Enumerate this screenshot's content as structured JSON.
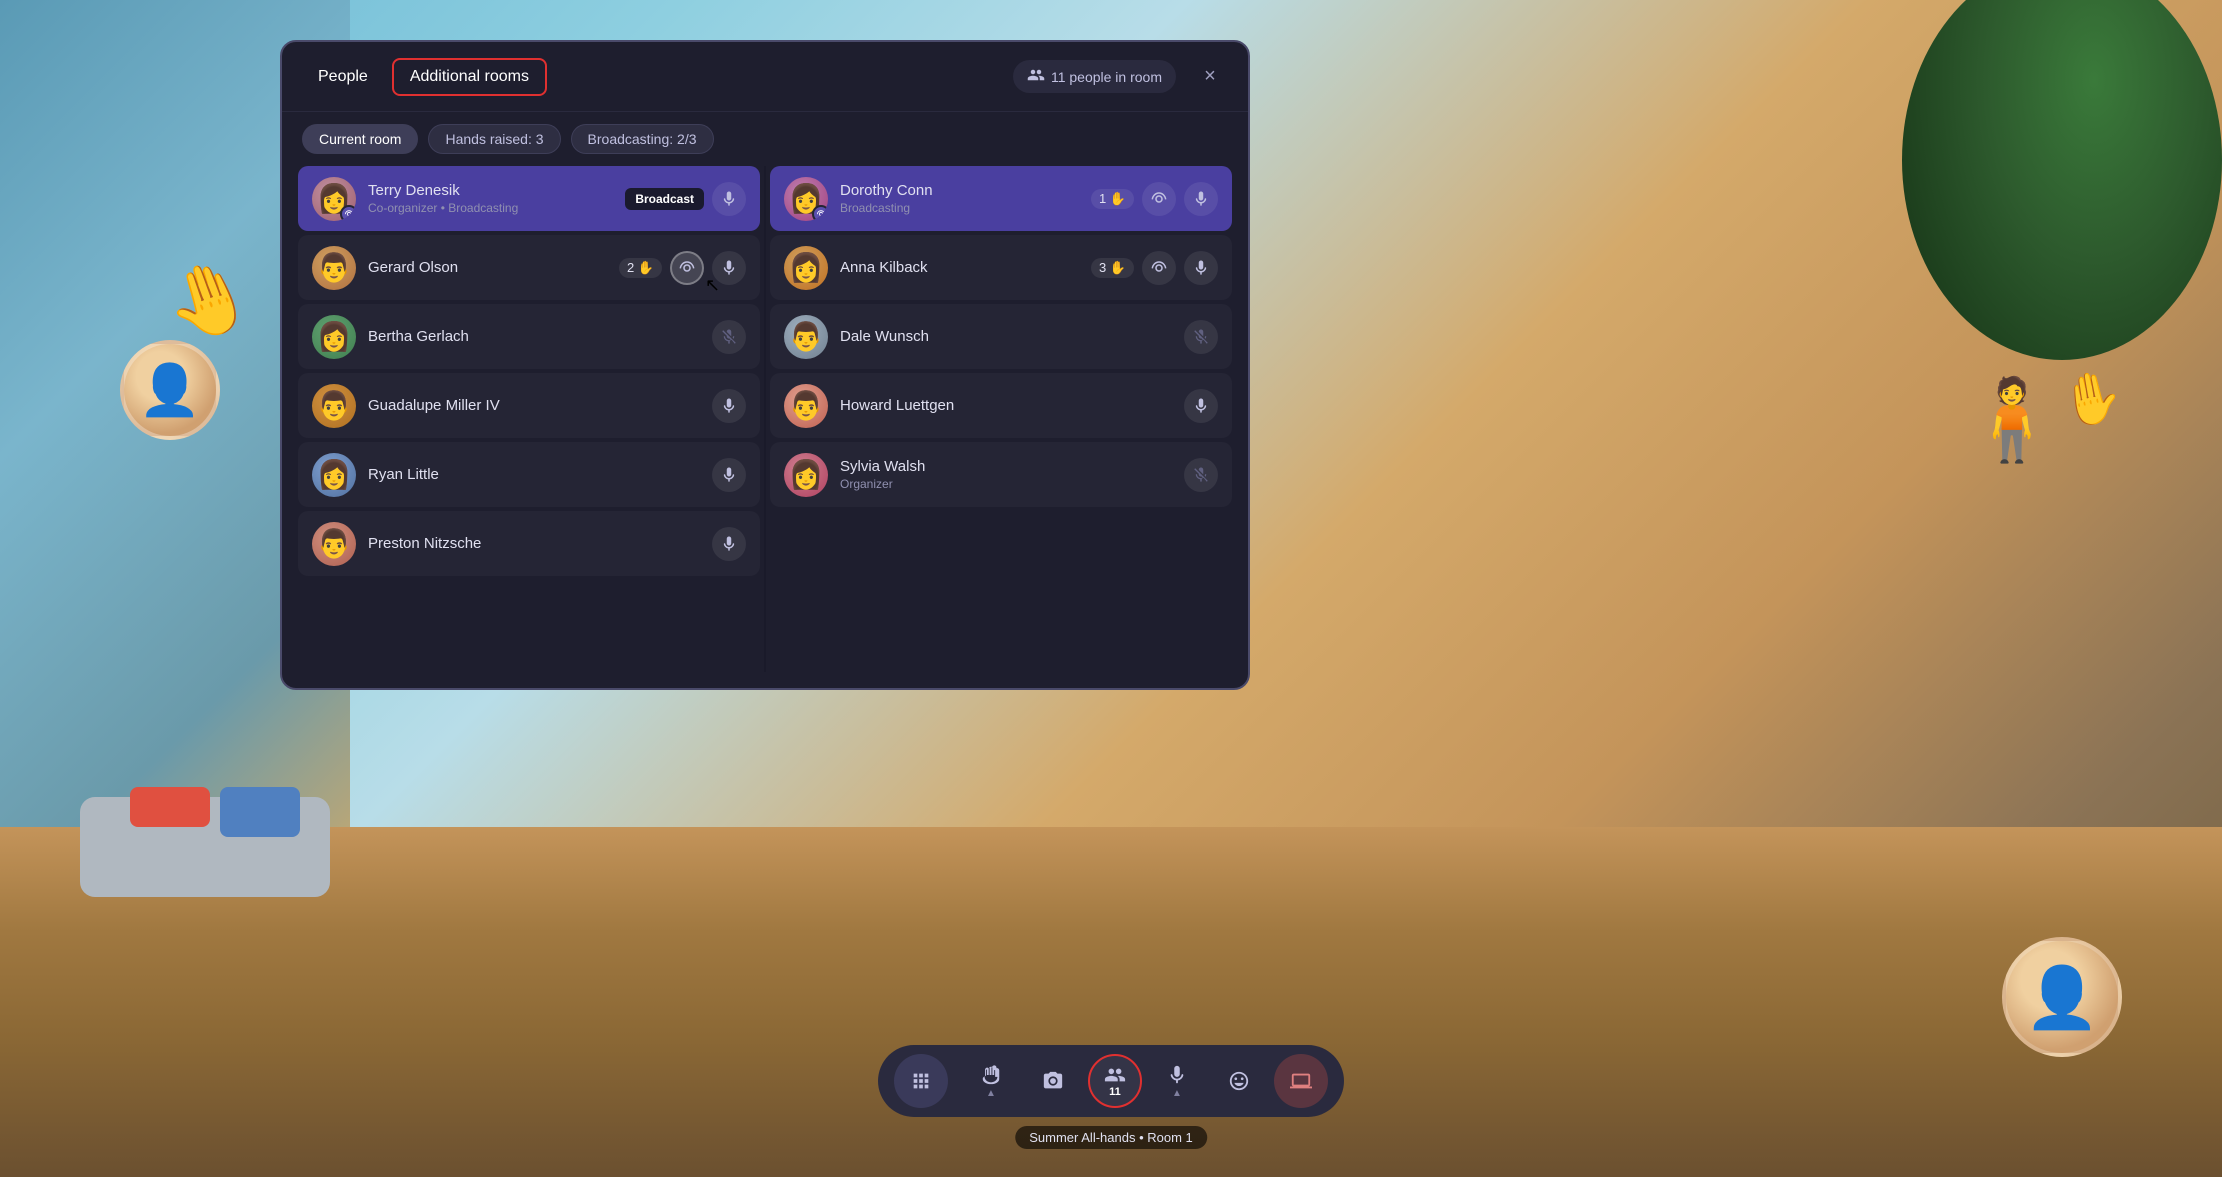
{
  "background": {
    "hand_emoji": "🤚",
    "hand_right_emoji": "✋"
  },
  "panel": {
    "tab_people": "People",
    "tab_additional_rooms": "Additional rooms",
    "people_count": "11 people in room",
    "close_label": "×",
    "filter_current_room": "Current room",
    "filter_hands_raised": "Hands raised: 3",
    "filter_broadcasting": "Broadcasting: 2/3"
  },
  "people": [
    {
      "id": "terry",
      "name": "Terry Denesik",
      "role": "Co-organizer • Broadcasting",
      "column": 0,
      "broadcasting": true,
      "badge": "Broadcast",
      "has_broadcast_icon": true,
      "mic_active": true,
      "muted": false,
      "avatar_class": "avatar-terry",
      "avatar_emoji": "👩"
    },
    {
      "id": "dorothy",
      "name": "Dorothy Conn",
      "role": "Broadcasting",
      "column": 1,
      "broadcasting": true,
      "hand_count": "1",
      "has_broadcast_icon": true,
      "mic_active": true,
      "muted": false,
      "avatar_class": "avatar-dorothy",
      "avatar_emoji": "👩"
    },
    {
      "id": "gerard",
      "name": "Gerard Olson",
      "role": "",
      "column": 0,
      "broadcasting": false,
      "hand_count": "2",
      "has_broadcast_icon": true,
      "broadcast_active": true,
      "mic_active": true,
      "muted": false,
      "avatar_class": "avatar-gerard",
      "avatar_emoji": "👨"
    },
    {
      "id": "anna",
      "name": "Anna Kilback",
      "role": "",
      "column": 1,
      "broadcasting": false,
      "hand_count": "3",
      "has_broadcast_icon": true,
      "mic_active": true,
      "muted": false,
      "avatar_class": "avatar-anna",
      "avatar_emoji": "👩"
    },
    {
      "id": "bertha",
      "name": "Bertha Gerlach",
      "role": "",
      "column": 0,
      "broadcasting": false,
      "mic_active": false,
      "muted": true,
      "avatar_class": "avatar-bertha",
      "avatar_emoji": "👩"
    },
    {
      "id": "dale",
      "name": "Dale Wunsch",
      "role": "",
      "column": 1,
      "broadcasting": false,
      "mic_active": false,
      "muted": true,
      "avatar_class": "avatar-dale",
      "avatar_emoji": "👨"
    },
    {
      "id": "guadalupe",
      "name": "Guadalupe Miller IV",
      "role": "",
      "column": 0,
      "broadcasting": false,
      "mic_active": true,
      "muted": false,
      "avatar_class": "avatar-guadalupe",
      "avatar_emoji": "👨"
    },
    {
      "id": "howard",
      "name": "Howard Luettgen",
      "role": "",
      "column": 1,
      "broadcasting": false,
      "mic_active": true,
      "muted": false,
      "avatar_class": "avatar-howard",
      "avatar_emoji": "👨"
    },
    {
      "id": "ryan",
      "name": "Ryan Little",
      "role": "",
      "column": 0,
      "broadcasting": false,
      "mic_active": true,
      "muted": false,
      "avatar_class": "avatar-ryan",
      "avatar_emoji": "👩"
    },
    {
      "id": "sylvia",
      "name": "Sylvia Walsh",
      "role": "Organizer",
      "column": 1,
      "broadcasting": false,
      "mic_active": false,
      "muted": true,
      "avatar_class": "avatar-sylvia",
      "avatar_emoji": "👩"
    },
    {
      "id": "preston",
      "name": "Preston Nitzsche",
      "role": "",
      "column": 0,
      "broadcasting": false,
      "mic_active": true,
      "muted": false,
      "avatar_class": "avatar-preston",
      "avatar_emoji": "👨"
    }
  ],
  "taskbar": {
    "apps_label": "⠿",
    "raise_hand": "⇑",
    "camera": "📷",
    "people_label": "👥",
    "people_count": "11",
    "emoji_label": "☺",
    "mic_label": "🎤",
    "share_label": "⊡",
    "room_label": "Summer All-hands • Room 1"
  }
}
